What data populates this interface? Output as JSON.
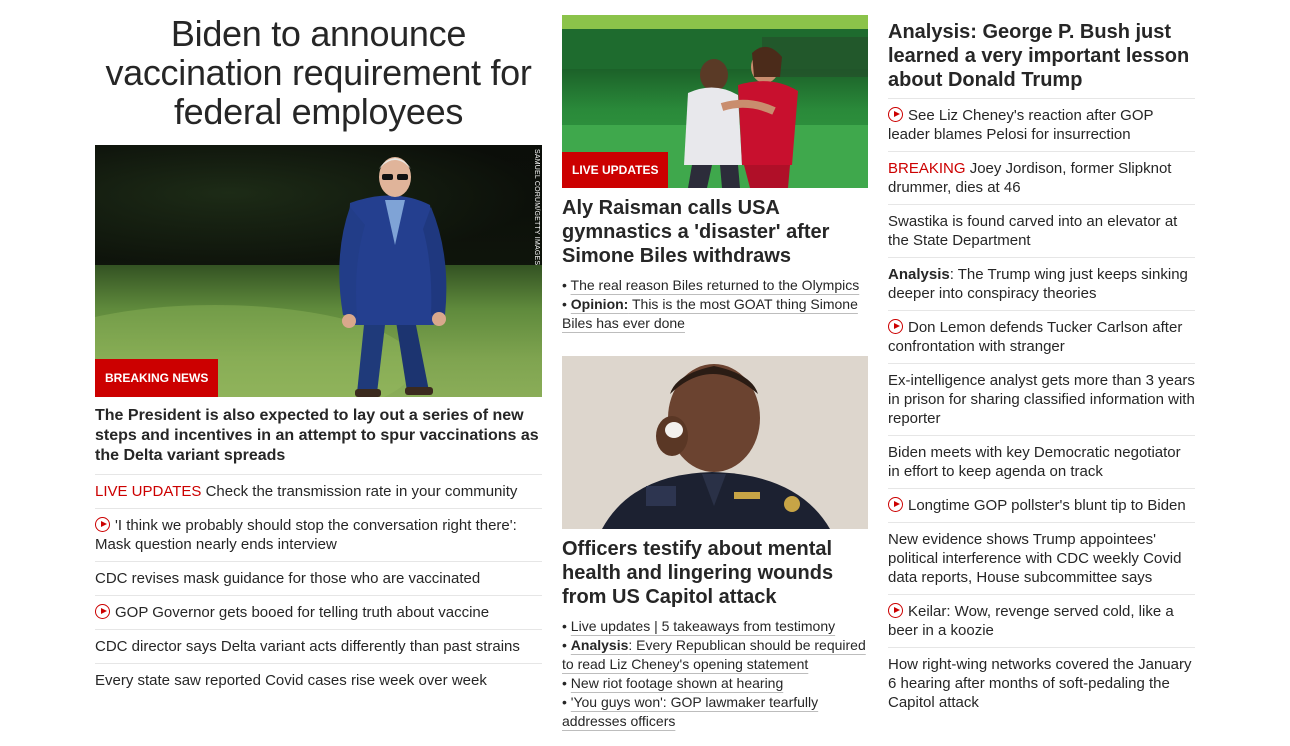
{
  "lead": {
    "headline": "Biden to announce vaccination requirement for federal employees",
    "photo_credit": "SAMUEL CORUM/GETTY IMAGES",
    "tag": "BREAKING NEWS",
    "description": "The President is also expected to lay out a series of new steps and incentives in an attempt to spur vaccinations as the Delta variant spreads",
    "list": [
      {
        "prefix": "LIVE UPDATES",
        "text": "Check the transmission rate in your community",
        "video": false
      },
      {
        "prefix": "",
        "text": "'I think we probably should stop the conversation right there': Mask question nearly ends interview",
        "video": true
      },
      {
        "prefix": "",
        "text": "CDC revises mask guidance for those who are vaccinated",
        "video": false
      },
      {
        "prefix": "",
        "text": "GOP Governor gets booed for telling truth about vaccine",
        "video": true
      },
      {
        "prefix": "",
        "text": "CDC director says Delta variant acts differently than past strains",
        "video": false
      },
      {
        "prefix": "",
        "text": "Every state saw reported Covid cases rise week over week",
        "video": false
      }
    ]
  },
  "middle": {
    "story1": {
      "tag": "LIVE UPDATES",
      "title": "Aly Raisman calls USA gymnastics a 'disaster' after Simone Biles withdraws",
      "bullets": [
        {
          "bold": "",
          "text": "The real reason Biles returned to the Olympics"
        },
        {
          "bold": "Opinion:",
          "text": " This is the most GOAT thing Simone Biles has ever done"
        }
      ]
    },
    "story2": {
      "title": "Officers testify about mental health and lingering wounds from US Capitol attack",
      "bullets": [
        {
          "bold": "",
          "text": "Live updates | 5 takeaways from testimony"
        },
        {
          "bold": "Analysis",
          "text": ": Every Republican should be required to read Liz Cheney's opening statement"
        },
        {
          "bold": "",
          "text": "New riot footage shown at hearing"
        },
        {
          "bold": "",
          "text": "'You guys won': GOP lawmaker tearfully addresses officers"
        }
      ]
    }
  },
  "right": {
    "title": "Analysis: George P. Bush just learned a very important lesson about Donald Trump",
    "items": [
      {
        "prefix": "",
        "bold": "",
        "text": "See Liz Cheney's reaction after GOP leader blames Pelosi for insurrection",
        "video": true
      },
      {
        "prefix": "BREAKING",
        "bold": "",
        "text": "Joey Jordison, former Slipknot drummer, dies at 46",
        "video": false
      },
      {
        "prefix": "",
        "bold": "",
        "text": "Swastika is found carved into an elevator at the State Department",
        "video": false
      },
      {
        "prefix": "",
        "bold": "Analysis",
        "text": ": The Trump wing just keeps sinking deeper into conspiracy theories",
        "video": false
      },
      {
        "prefix": "",
        "bold": "",
        "text": "Don Lemon defends Tucker Carlson after confrontation with stranger",
        "video": true
      },
      {
        "prefix": "",
        "bold": "",
        "text": "Ex-intelligence analyst gets more than 3 years in prison for sharing classified information with reporter",
        "video": false
      },
      {
        "prefix": "",
        "bold": "",
        "text": "Biden meets with key Democratic negotiator in effort to keep agenda on track",
        "video": false
      },
      {
        "prefix": "",
        "bold": "",
        "text": "Longtime GOP pollster's blunt tip to Biden",
        "video": true
      },
      {
        "prefix": "",
        "bold": "",
        "text": "New evidence shows Trump appointees' political interference with CDC weekly Covid data reports, House subcommittee says",
        "video": false
      },
      {
        "prefix": "",
        "bold": "",
        "text": "Keilar: Wow, revenge served cold, like a beer in a koozie",
        "video": true
      },
      {
        "prefix": "",
        "bold": "",
        "text": "How right-wing networks covered the January 6 hearing after months of soft-pedaling the Capitol attack",
        "video": false
      }
    ]
  },
  "colors": {
    "accent": "#cc0000",
    "text": "#262626",
    "divider": "#e6e6e6"
  },
  "icons": {
    "video": "play-circle-icon"
  }
}
